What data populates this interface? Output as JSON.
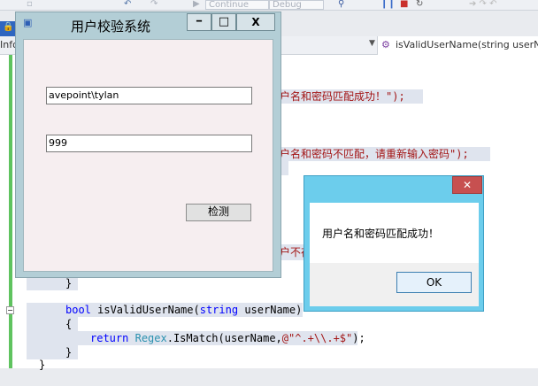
{
  "ide": {
    "toolbar": {
      "continue_label": "Continue",
      "config_value": "Debug"
    },
    "nav": {
      "left_label": "Info",
      "method_combo": "isValidUserName(string userNa"
    },
    "code": {
      "frag1": "户名和密码匹配成功！\");",
      "frag2": "户名和密码不匹配，请重新输入密码\");",
      "frag3": "户不存",
      "brace1": "}",
      "l_sig_kw": "bool",
      "l_sig_name": " isValidUserName(",
      "l_sig_type": "string",
      "l_sig_param": " userName)",
      "l_open": "{",
      "l_ret_kw": "return",
      "l_ret_type": "Regex",
      "l_ret_call": ".IsMatch(userName,",
      "l_ret_str": "@\"^.+\\\\.+$\"",
      "l_ret_end": ");",
      "l_close": "}",
      "l_close2": "}"
    }
  },
  "form": {
    "title": "用户校验系统",
    "username": "avepoint\\tylan",
    "password": "999",
    "check_button": "检测",
    "minimize": "━",
    "maximize": "□",
    "close": "X"
  },
  "msgbox": {
    "message": "用户名和密码匹配成功！",
    "ok": "OK",
    "close": "✕"
  },
  "colors": {
    "form_frame": "#b3ced6",
    "form_client": "#f6eef0",
    "msgbox_frame": "#6ccdec",
    "msgbox_close": "#c75050"
  }
}
